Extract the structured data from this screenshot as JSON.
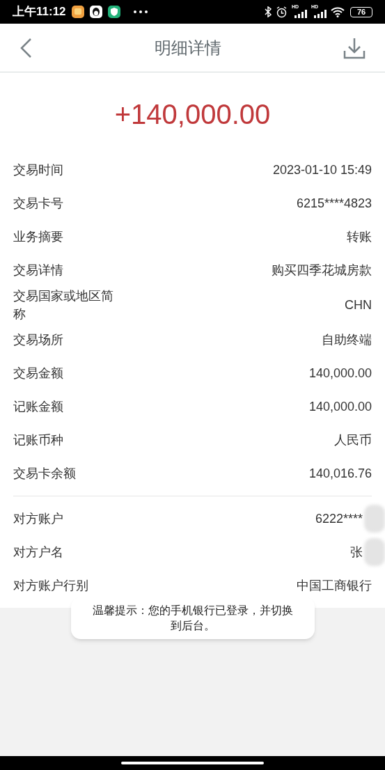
{
  "status_bar": {
    "time": "上午11:12",
    "signal_labels": [
      "HD",
      "HD"
    ],
    "battery": "76"
  },
  "header": {
    "title": "明细详情"
  },
  "amount": "+140,000.00",
  "sections": [
    {
      "rows": [
        {
          "label": "交易时间",
          "value": "2023-01-10 15:49"
        },
        {
          "label": "交易卡号",
          "value": "6215****4823"
        },
        {
          "label": "业务摘要",
          "value": "转账"
        },
        {
          "label": "交易详情",
          "value": "购买四季花城房款"
        },
        {
          "label": "交易国家或地区简称",
          "value": "CHN"
        },
        {
          "label": "交易场所",
          "value": "自助终端"
        },
        {
          "label": "交易金额",
          "value": "140,000.00"
        },
        {
          "label": "记账金额",
          "value": "140,000.00"
        },
        {
          "label": "记账币种",
          "value": "人民币"
        },
        {
          "label": "交易卡余额",
          "value": "140,016.76"
        }
      ]
    },
    {
      "rows": [
        {
          "label": "对方账户",
          "value": "6222****",
          "redacted": true
        },
        {
          "label": "对方户名",
          "value": "张",
          "redacted": true
        },
        {
          "label": "对方账户行别",
          "value": "中国工商银行",
          "redacted": false
        }
      ]
    }
  ],
  "toast": "温馨提示：您的手机银行已登录，并切换到后台。"
}
